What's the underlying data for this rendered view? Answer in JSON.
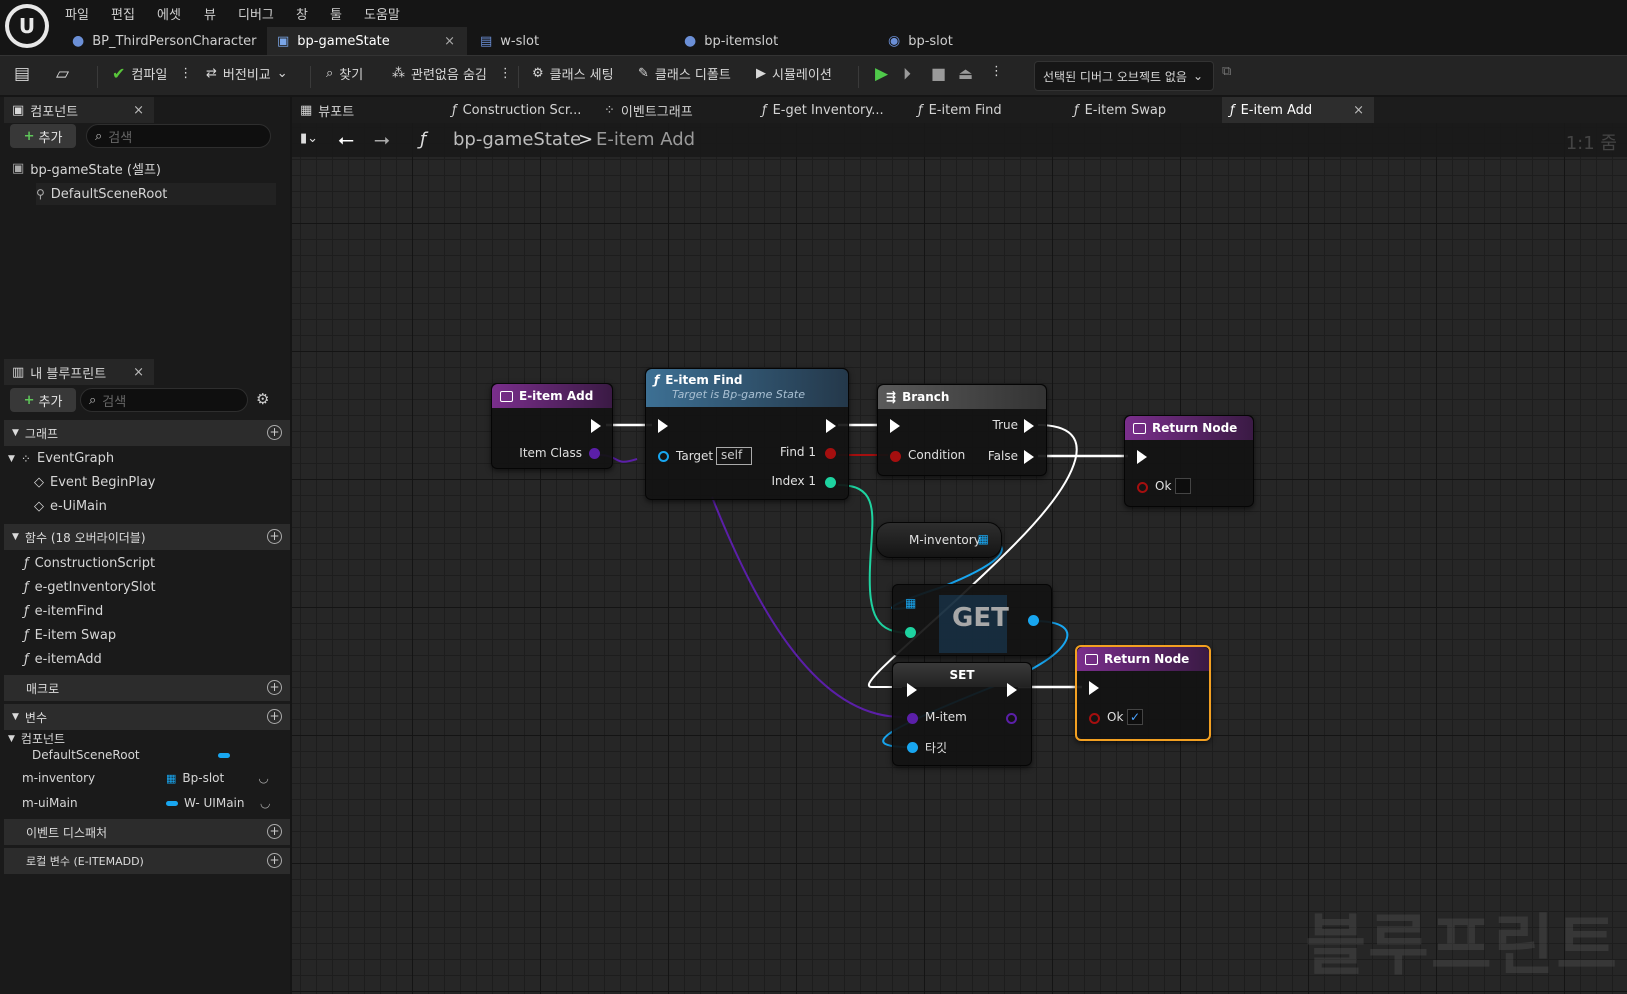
{
  "menu": [
    "파일",
    "편집",
    "에셋",
    "뷰",
    "디버그",
    "창",
    "툴",
    "도움말"
  ],
  "doc_tabs": [
    {
      "label": "BP_ThirdPersonCharacter"
    },
    {
      "label": "bp-gameState"
    },
    {
      "label": "w-slot"
    },
    {
      "label": "bp-itemslot"
    },
    {
      "label": "bp-slot"
    }
  ],
  "close_glyph": "×",
  "toolbar": {
    "compile": "컴파일",
    "diff": "버전비교",
    "find": "찾기",
    "hide_unrelated": "관련없음 숨김",
    "class_settings": "클래스 세팅",
    "class_defaults": "클래스 디폴트",
    "simulation": "시뮬레이션",
    "debug_object": "선택된 디버그 오브젝트 없음"
  },
  "components_panel": {
    "tab": "컴포넌트",
    "add": "추가",
    "search_placeholder": "검색",
    "root": "bp-gameState (셀프)",
    "child": "DefaultSceneRoot"
  },
  "my_blueprint": {
    "tab": "내 블루프린트",
    "add": "추가",
    "search_placeholder": "검색",
    "sections": {
      "graph": "그래프",
      "functions": "함수 (18 오버라이더블)",
      "macros": "매크로",
      "variables": "변수",
      "components": "컴포넌트",
      "event_dispatchers": "이벤트 디스패처",
      "local_vars": "로컬 변수 (E-ITEMADD)"
    },
    "graph_items": [
      "EventGraph",
      "Event BeginPlay",
      "e-UiMain"
    ],
    "function_items": [
      "ConstructionScript",
      "e-getInventorySlot",
      "e-itemFind",
      "E-item Swap",
      "e-itemAdd"
    ],
    "component_vars": [
      {
        "name": "DefaultSceneRoot",
        "type": ""
      },
      {
        "name": "m-inventory",
        "type": "Bp-slot"
      },
      {
        "name": "m-uiMain",
        "type": "W- UIMain"
      }
    ]
  },
  "graph_tabs": [
    "뷰포트",
    "Construction Scr...",
    "이벤트그래프",
    "E-get Inventory...",
    "E-item Find",
    "E-item Swap",
    "E-item Add"
  ],
  "breadcrumb": {
    "root": "bp-gameState",
    "sep": ">",
    "current": "E-item Add"
  },
  "zoom": "1:1 줌",
  "watermark": "블루프린트",
  "nodes": {
    "entry": {
      "title": "E-item Add",
      "pin_item_class": "Item Class"
    },
    "find": {
      "title": "E-item Find",
      "subtitle": "Target is Bp-game State",
      "pin_target": "Target",
      "target_value": "self",
      "pin_find": "Find 1",
      "pin_index": "Index 1"
    },
    "branch": {
      "title": "Branch",
      "pin_condition": "Condition",
      "pin_true": "True",
      "pin_false": "False"
    },
    "return1": {
      "title": "Return Node",
      "pin_ok": "Ok",
      "ok_checked": false
    },
    "inventory": {
      "label": "M-inventory"
    },
    "get": {
      "label": "GET"
    },
    "set": {
      "title": "SET",
      "pin_item": "M-item",
      "pin_target": "타깃"
    },
    "return2": {
      "title": "Return Node",
      "pin_ok": "Ok",
      "ok_checked": true
    }
  },
  "colors": {
    "function_header": "#6a2d7a",
    "branch_header": "#4a4a4a",
    "find_header": "#2f5c78",
    "exec_wire": "#ffffff",
    "class_pin": "#5b1fa8",
    "bool_pin": "#a50f0f",
    "int_pin": "#1ed3a0",
    "object_pin": "#18a6f0",
    "selected_outline": "#f3a021"
  }
}
